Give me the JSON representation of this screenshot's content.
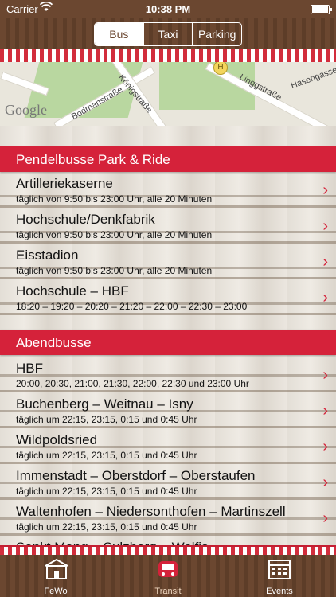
{
  "status": {
    "carrier": "Carrier",
    "time": "10:38 PM"
  },
  "segments": [
    "Bus",
    "Taxi",
    "Parking"
  ],
  "segments_active": "Bus",
  "map": {
    "logo": "Google",
    "streets": [
      "Bodmanstraße",
      "Königstraße",
      "Linggstraße",
      "Hasengasse"
    ]
  },
  "sections": [
    {
      "title": "Pendelbusse Park & Ride",
      "rows": [
        {
          "title": "Artilleriekaserne",
          "sub": "täglich von 9:50 bis 23:00 Uhr, alle 20 Minuten"
        },
        {
          "title": "Hochschule/Denkfabrik",
          "sub": "täglich von 9:50 bis 23:00 Uhr, alle 20 Minuten"
        },
        {
          "title": "Eisstadion",
          "sub": "täglich von 9:50 bis 23:00 Uhr, alle 20 Minuten"
        },
        {
          "title": "Hochschule – HBF",
          "sub": "18:20 – 19:20 – 20:20 – 21:20 – 22:00 – 22:30 – 23:00"
        }
      ]
    },
    {
      "title": "Abendbusse",
      "rows": [
        {
          "title": "HBF",
          "sub": "20:00, 20:30, 21:00, 21:30, 22:00, 22:30 und 23:00 Uhr"
        },
        {
          "title": "Buchenberg – Weitnau – Isny",
          "sub": "täglich um 22:15, 23:15, 0:15 und 0:45 Uhr"
        },
        {
          "title": "Wildpoldsried",
          "sub": "täglich um 22:15, 23:15, 0:15 und 0:45 Uhr"
        },
        {
          "title": "Immenstadt – Oberstdorf – Oberstaufen",
          "sub": "täglich um 22:15, 23:15, 0:15 und 0:45 Uhr"
        },
        {
          "title": "Waltenhofen – Niedersonthofen – Martinszell",
          "sub": "täglich um 22:15, 23:15, 0:15 und 0:45 Uhr"
        },
        {
          "title": "Sankt Mang – Sulzberg – Wolfis",
          "sub": ""
        }
      ]
    }
  ],
  "tabs": [
    {
      "label": "FeWo",
      "icon": "house-icon"
    },
    {
      "label": "Transit",
      "icon": "bus-icon"
    },
    {
      "label": "Events",
      "icon": "calendar-icon"
    }
  ],
  "tabs_active": "Transit",
  "colors": {
    "accent_red": "#d5223a",
    "wood": "#6b4730"
  }
}
